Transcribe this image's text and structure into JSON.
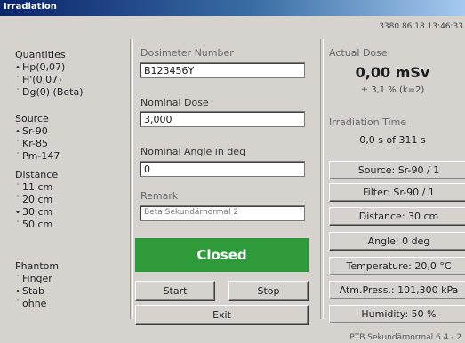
{
  "window": {
    "title": "Irradiation"
  },
  "status_datetime": "3380.86.18 13:46:33",
  "left": {
    "quantities": {
      "title": "Quantities",
      "options": [
        {
          "label": "Hp(0,07)",
          "selected": true
        },
        {
          "label": "H'(0,07)",
          "selected": false
        },
        {
          "label": "Dg(0) (Beta)",
          "selected": false
        }
      ]
    },
    "source": {
      "title": "Source",
      "options": [
        {
          "label": "Sr-90",
          "selected": true
        },
        {
          "label": "Kr-85",
          "selected": false
        },
        {
          "label": "Pm-147",
          "selected": false
        }
      ]
    },
    "distance": {
      "title": "Distance",
      "options": [
        {
          "label": "11 cm",
          "selected": false
        },
        {
          "label": "20 cm",
          "selected": false
        },
        {
          "label": "30 cm",
          "selected": true
        },
        {
          "label": "50 cm",
          "selected": false
        }
      ]
    },
    "phantom": {
      "title": "Phantom",
      "options": [
        {
          "label": "Finger",
          "selected": false
        },
        {
          "label": "Stab",
          "selected": true
        },
        {
          "label": "ohne",
          "selected": false
        }
      ]
    }
  },
  "middle": {
    "dosimeter_label": "Dosimeter Number",
    "dosimeter_value": "B123456Y",
    "nominal_dose_label": "Nominal Dose",
    "nominal_dose_value": "3,000",
    "nominal_angle_label": "Nominal Angle in deg",
    "nominal_angle_value": "0",
    "remark_label": "Remark",
    "remark_value": "Beta Sekundärnormal 2",
    "status_label": "Closed",
    "start_label": "Start",
    "stop_label": "Stop",
    "exit_label": "Exit"
  },
  "right": {
    "actual_dose_label": "Actual Dose",
    "actual_dose_value": "0,00 mSv",
    "actual_dose_uncert": "± 3,1 % (k=2)",
    "irr_time_label": "Irradiation Time",
    "irr_time_value": "0,0 s of 311 s",
    "source_label": "Source: Sr-90 / 1",
    "filter_label": "Filter: Sr-90 / 1",
    "distance_label": "Distance: 30 cm",
    "angle_label": "Angle: 0 deg",
    "temperature_label": "Temperature: 20,0 °C",
    "pressure_label": "Atm.Press.: 101,300 kPa",
    "humidity_label": "Humidity: 50 %"
  },
  "footer": "PTB Sekundärnormal 6.4 - 2"
}
